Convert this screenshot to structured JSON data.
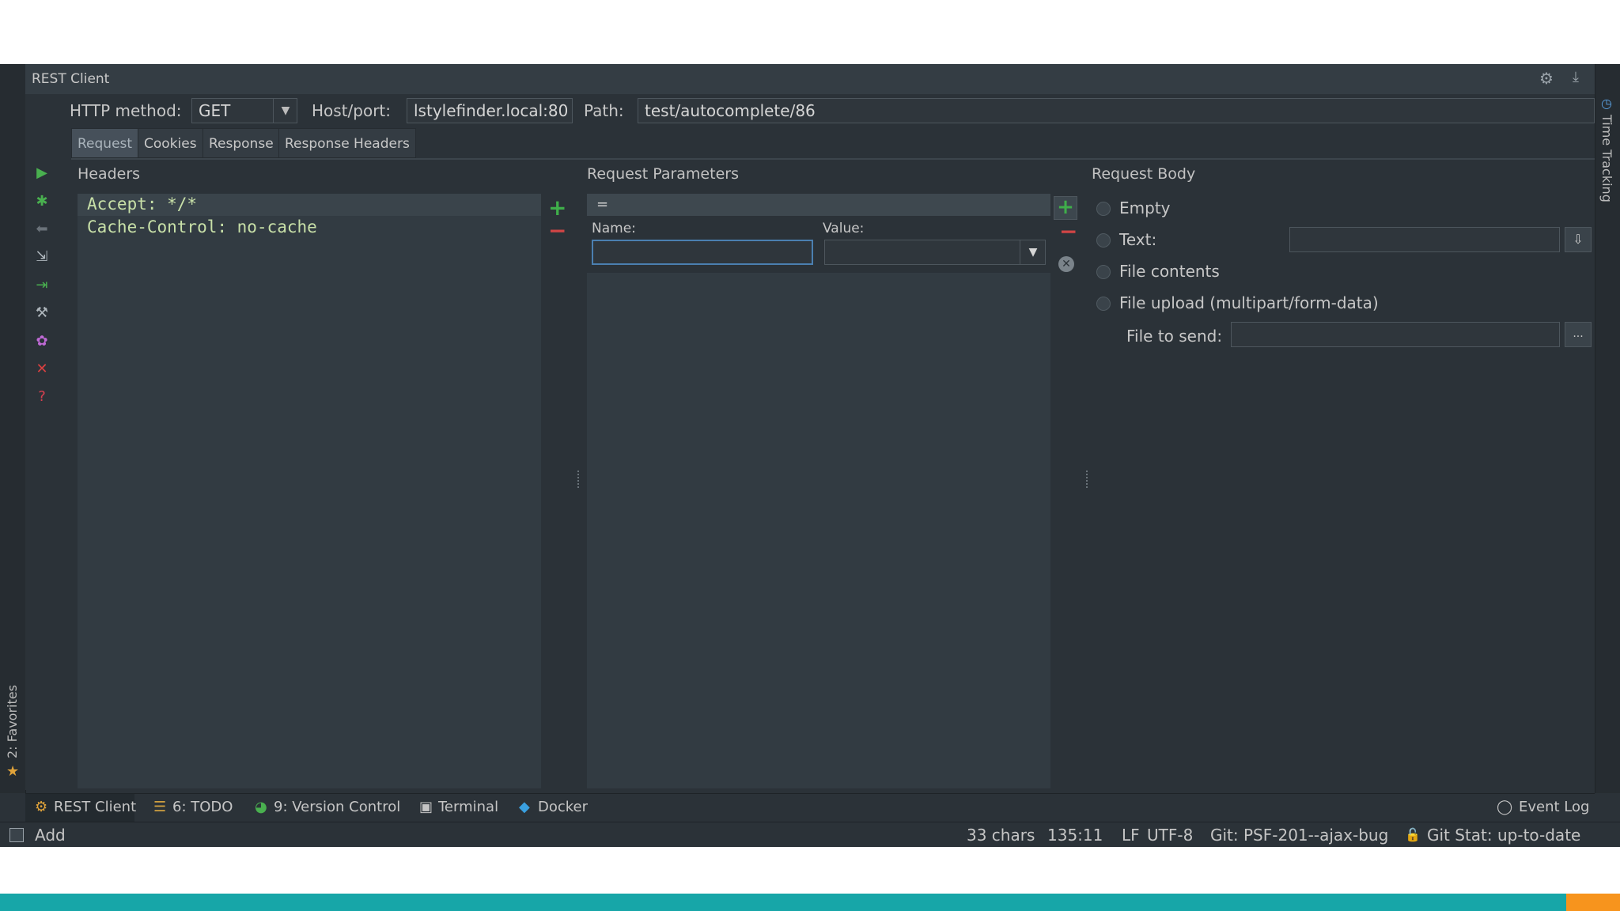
{
  "window": {
    "title": "REST Client"
  },
  "toolbar": {
    "http_method_label": "HTTP method:",
    "http_method_value": "GET",
    "host_label": "Host/port:",
    "host_value": "lstylefinder.local:80",
    "path_label": "Path:",
    "path_value": "test/autocomplete/86"
  },
  "tabs": [
    "Request",
    "Cookies",
    "Response",
    "Response Headers"
  ],
  "headers": {
    "title": "Headers",
    "lines": [
      "Accept: */*",
      "Cache-Control: no-cache"
    ]
  },
  "params": {
    "title": "Request Parameters",
    "list_row": "=",
    "name_label": "Name:",
    "value_label": "Value:",
    "name_value": "",
    "value_value": ""
  },
  "body": {
    "title": "Request Body",
    "options": [
      "Empty",
      "Text:",
      "File contents",
      "File upload (multipart/form-data)"
    ],
    "file_to_send_label": "File to send:",
    "browse_label": "..."
  },
  "right_strip": {
    "label": "Time Tracking"
  },
  "left_strip": {
    "label": "2: Favorites"
  },
  "tool_windows": [
    {
      "label": "REST Client",
      "icon": "rest-client-icon"
    },
    {
      "label": "6: TODO",
      "icon": "todo-icon"
    },
    {
      "label": "9: Version Control",
      "icon": "version-control-icon"
    },
    {
      "label": "Terminal",
      "icon": "terminal-icon"
    },
    {
      "label": "Docker",
      "icon": "docker-icon"
    }
  ],
  "event_log": "Event Log",
  "status": {
    "add": "Add",
    "chars": "33 chars",
    "position": "135:11",
    "line_sep": "LF",
    "encoding": "UTF-8",
    "git_branch": "Git: PSF-201--ajax-bug",
    "git_stat": "Git Stat: up-to-date"
  },
  "colors": {
    "accent_green": "#3fae4a",
    "accent_red": "#d14545",
    "band": "#17a6a8",
    "band_accent": "#f7941d"
  }
}
